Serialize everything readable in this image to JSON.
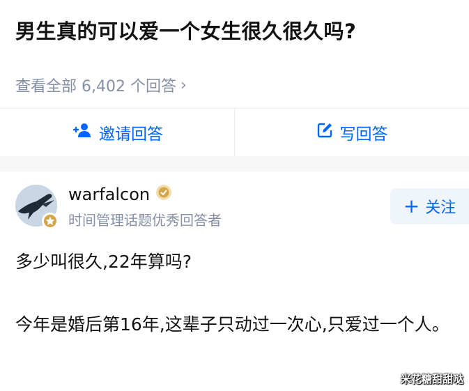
{
  "question": {
    "title": "男生真的可以爱一个女生很久很久吗?",
    "view_all": "查看全部 6,402 个回答"
  },
  "actions": {
    "invite_label": "邀请回答",
    "write_label": "写回答",
    "invite_icon": "add-person-icon",
    "write_icon": "edit-icon"
  },
  "author": {
    "name": "warfalcon",
    "description": "时间管理话题优秀回答者",
    "follow_label": "关注"
  },
  "answer": {
    "paragraph1": "多少叫很久,22年算吗?",
    "paragraph2": "今年是婚后第16年,这辈子只动过一次心,只爱过一个人。"
  },
  "watermark": "米花糖甜甜哒",
  "colors": {
    "accent": "#0066ff",
    "muted": "#8590a6",
    "badge_gold": "#d4a54a"
  }
}
